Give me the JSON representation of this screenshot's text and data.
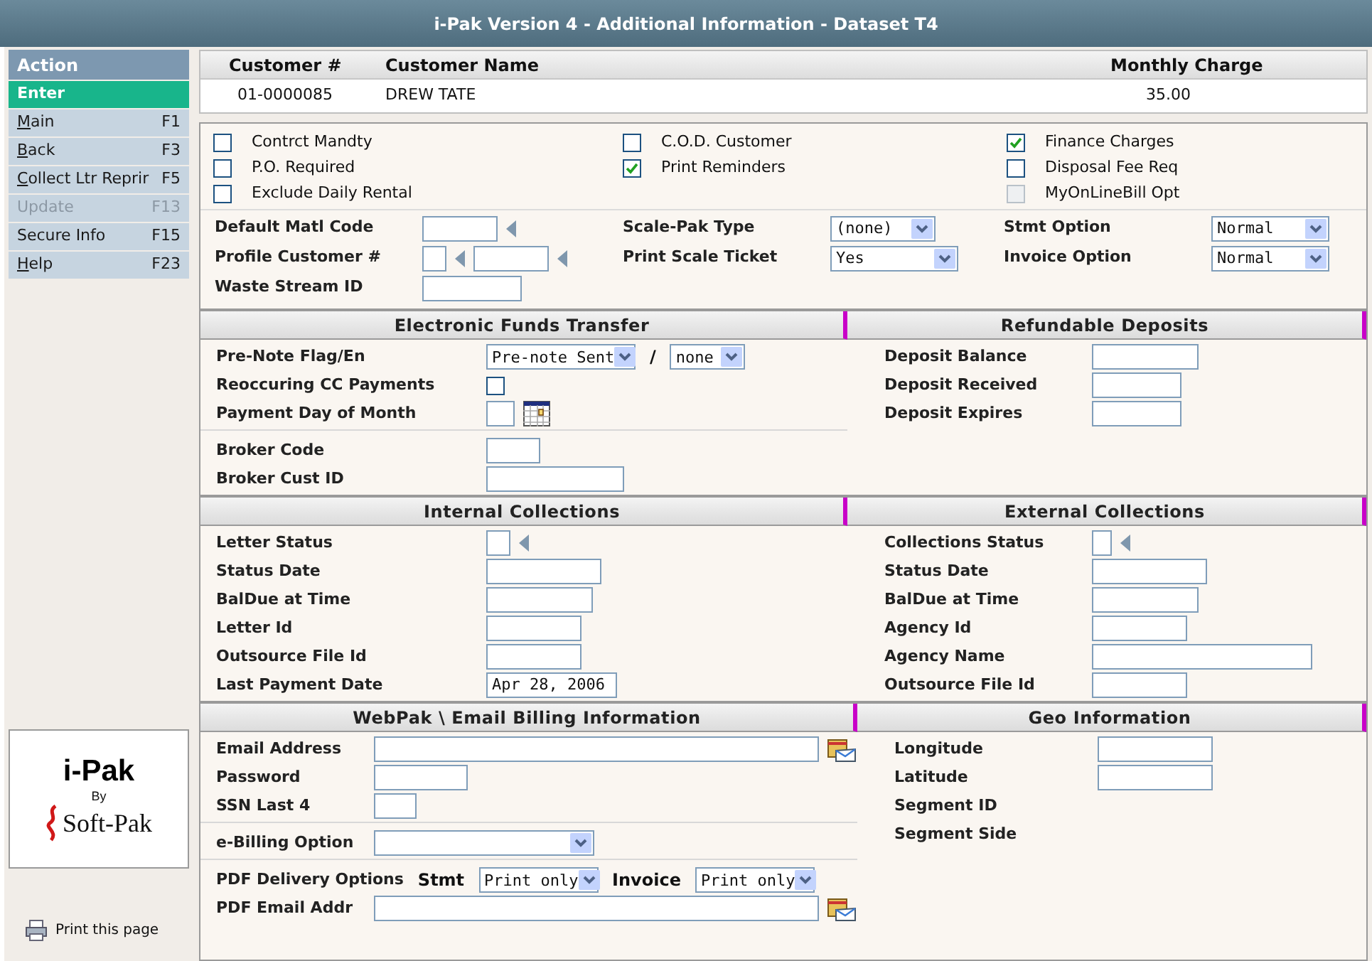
{
  "window": {
    "title": "i-Pak Version 4 - Additional Information - Dataset T4"
  },
  "sidebar": {
    "header": "Action",
    "items": [
      {
        "label": "Enter",
        "kind": "primary",
        "disabled": false,
        "mnemonic": false
      },
      {
        "label": "Main",
        "key": "F1",
        "kind": "item",
        "disabled": false,
        "mnemonic": true
      },
      {
        "label": "Back",
        "key": "F3",
        "kind": "item",
        "disabled": false,
        "mnemonic": true
      },
      {
        "label": "Collect Ltr Reprir",
        "key": "F5",
        "kind": "item",
        "disabled": false,
        "mnemonic": true
      },
      {
        "label": "Update",
        "key": "F13",
        "kind": "item",
        "disabled": true,
        "mnemonic": false
      },
      {
        "label": "Secure Info",
        "key": "F15",
        "kind": "item",
        "disabled": false,
        "mnemonic": false
      },
      {
        "label": "Help",
        "key": "F23",
        "kind": "item",
        "disabled": false,
        "mnemonic": true
      }
    ]
  },
  "logo": {
    "product": "i-Pak",
    "by": "By",
    "maker": "Soft-Pak"
  },
  "print_link": "Print this page",
  "customer": {
    "columns": [
      "Customer #",
      "Customer Name",
      "Monthly Charge"
    ],
    "row": [
      "01-0000085",
      "DREW TATE",
      "35.00"
    ]
  },
  "flags": [
    [
      {
        "label": "Contrct Mandty",
        "checked": false,
        "disabled": false
      },
      {
        "label": "P.O. Required",
        "checked": false,
        "disabled": false
      },
      {
        "label": "Exclude Daily Rental",
        "checked": false,
        "disabled": false
      }
    ],
    [
      {
        "label": "C.O.D. Customer",
        "checked": false,
        "disabled": false
      },
      {
        "label": "Print Reminders",
        "checked": true,
        "disabled": false
      }
    ],
    [
      {
        "label": "Finance Charges",
        "checked": true,
        "disabled": false
      },
      {
        "label": "Disposal Fee Req",
        "checked": false,
        "disabled": false
      },
      {
        "label": "MyOnLineBill Opt",
        "checked": false,
        "disabled": true
      }
    ]
  ],
  "settings": [
    [
      {
        "label": "Default Matl Code",
        "controls": [
          {
            "kind": "input"
          },
          {
            "kind": "lookup"
          }
        ]
      },
      {
        "label": "Profile Customer #",
        "controls": [
          {
            "kind": "input"
          },
          {
            "kind": "lookup"
          },
          {
            "kind": "input"
          },
          {
            "kind": "lookup"
          }
        ]
      },
      {
        "label": "Waste Stream ID",
        "controls": [
          {
            "kind": "input"
          }
        ]
      }
    ],
    [
      {
        "label": "Scale-Pak Type",
        "controls": [
          {
            "kind": "select",
            "value": "(none)"
          }
        ]
      },
      {
        "label": "Print Scale Ticket",
        "controls": [
          {
            "kind": "select",
            "value": "Yes"
          }
        ]
      }
    ],
    [
      {
        "label": "Stmt Option",
        "controls": [
          {
            "kind": "select",
            "value": "Normal"
          }
        ]
      },
      {
        "label": "Invoice Option",
        "controls": [
          {
            "kind": "select",
            "value": "Normal"
          }
        ]
      }
    ]
  ],
  "sections": [
    [
      {
        "title": "Electronic Funds Transfer",
        "groups": [
          [
            {
              "label": "Pre-Note Flag/En",
              "controls": [
                {
                  "kind": "select",
                  "value": "Pre-note Sent"
                },
                {
                  "kind": "text",
                  "text": "/"
                },
                {
                  "kind": "select",
                  "value": "none"
                }
              ]
            },
            {
              "label": "Reoccuring CC Payments",
              "controls": [
                {
                  "kind": "checkbox",
                  "checked": false
                }
              ]
            },
            {
              "label": "Payment Day of Month",
              "controls": [
                {
                  "kind": "input"
                },
                {
                  "kind": "calendar"
                }
              ]
            }
          ],
          [
            {
              "label": "Broker Code",
              "controls": [
                {
                  "kind": "input"
                }
              ]
            },
            {
              "label": "Broker Cust ID",
              "controls": [
                {
                  "kind": "input"
                }
              ]
            }
          ]
        ]
      },
      {
        "title": "Refundable Deposits",
        "groups": [
          [
            {
              "label": "Deposit Balance",
              "controls": [
                {
                  "kind": "input"
                }
              ]
            },
            {
              "label": "Deposit Received",
              "controls": [
                {
                  "kind": "input"
                }
              ]
            },
            {
              "label": "Deposit Expires",
              "controls": [
                {
                  "kind": "input"
                }
              ]
            }
          ]
        ]
      }
    ],
    [
      {
        "title": "Internal Collections",
        "groups": [
          [
            {
              "label": "Letter Status",
              "controls": [
                {
                  "kind": "input"
                },
                {
                  "kind": "lookup"
                }
              ]
            },
            {
              "label": "Status Date",
              "controls": [
                {
                  "kind": "input"
                }
              ]
            },
            {
              "label": "BalDue at Time",
              "controls": [
                {
                  "kind": "input"
                }
              ]
            },
            {
              "label": "Letter Id",
              "controls": [
                {
                  "kind": "input"
                }
              ]
            },
            {
              "label": "Outsource File Id",
              "controls": [
                {
                  "kind": "input"
                }
              ]
            },
            {
              "label": "Last Payment Date",
              "controls": [
                {
                  "kind": "input",
                  "value": "Apr 28, 2006"
                }
              ]
            }
          ]
        ]
      },
      {
        "title": "External Collections",
        "groups": [
          [
            {
              "label": "Collections Status",
              "controls": [
                {
                  "kind": "input"
                },
                {
                  "kind": "lookup"
                }
              ]
            },
            {
              "label": "Status Date",
              "controls": [
                {
                  "kind": "input"
                }
              ]
            },
            {
              "label": "BalDue at Time",
              "controls": [
                {
                  "kind": "input"
                }
              ]
            },
            {
              "label": "Agency Id",
              "controls": [
                {
                  "kind": "input"
                }
              ]
            },
            {
              "label": "Agency Name",
              "controls": [
                {
                  "kind": "input"
                }
              ]
            },
            {
              "label": "Outsource File Id",
              "controls": [
                {
                  "kind": "input"
                }
              ]
            }
          ]
        ]
      }
    ],
    [
      {
        "title": "WebPak \\ Email Billing Information",
        "groups": [
          [
            {
              "label": "Email Address",
              "controls": [
                {
                  "kind": "input"
                },
                {
                  "kind": "email"
                }
              ]
            },
            {
              "label": "Password",
              "controls": [
                {
                  "kind": "input"
                }
              ]
            },
            {
              "label": "SSN Last 4",
              "controls": [
                {
                  "kind": "input"
                }
              ]
            }
          ],
          [
            {
              "label": "e-Billing Option",
              "controls": [
                {
                  "kind": "select"
                }
              ]
            }
          ],
          [
            {
              "label": "PDF Delivery Options",
              "controls": [
                {
                  "kind": "text",
                  "text": "Stmt"
                },
                {
                  "kind": "select",
                  "value": "Print only"
                },
                {
                  "kind": "text",
                  "text": "Invoice"
                },
                {
                  "kind": "select",
                  "value": "Print only"
                }
              ]
            },
            {
              "label": "PDF Email Addr",
              "controls": [
                {
                  "kind": "input"
                },
                {
                  "kind": "email"
                }
              ]
            }
          ]
        ]
      },
      {
        "title": "Geo Information",
        "groups": [
          [
            {
              "label": "Longitude",
              "controls": [
                {
                  "kind": "input"
                }
              ]
            },
            {
              "label": "Latitude",
              "controls": [
                {
                  "kind": "input"
                }
              ]
            },
            {
              "label": "Segment ID"
            },
            {
              "label": "Segment Side"
            }
          ]
        ]
      }
    ]
  ]
}
